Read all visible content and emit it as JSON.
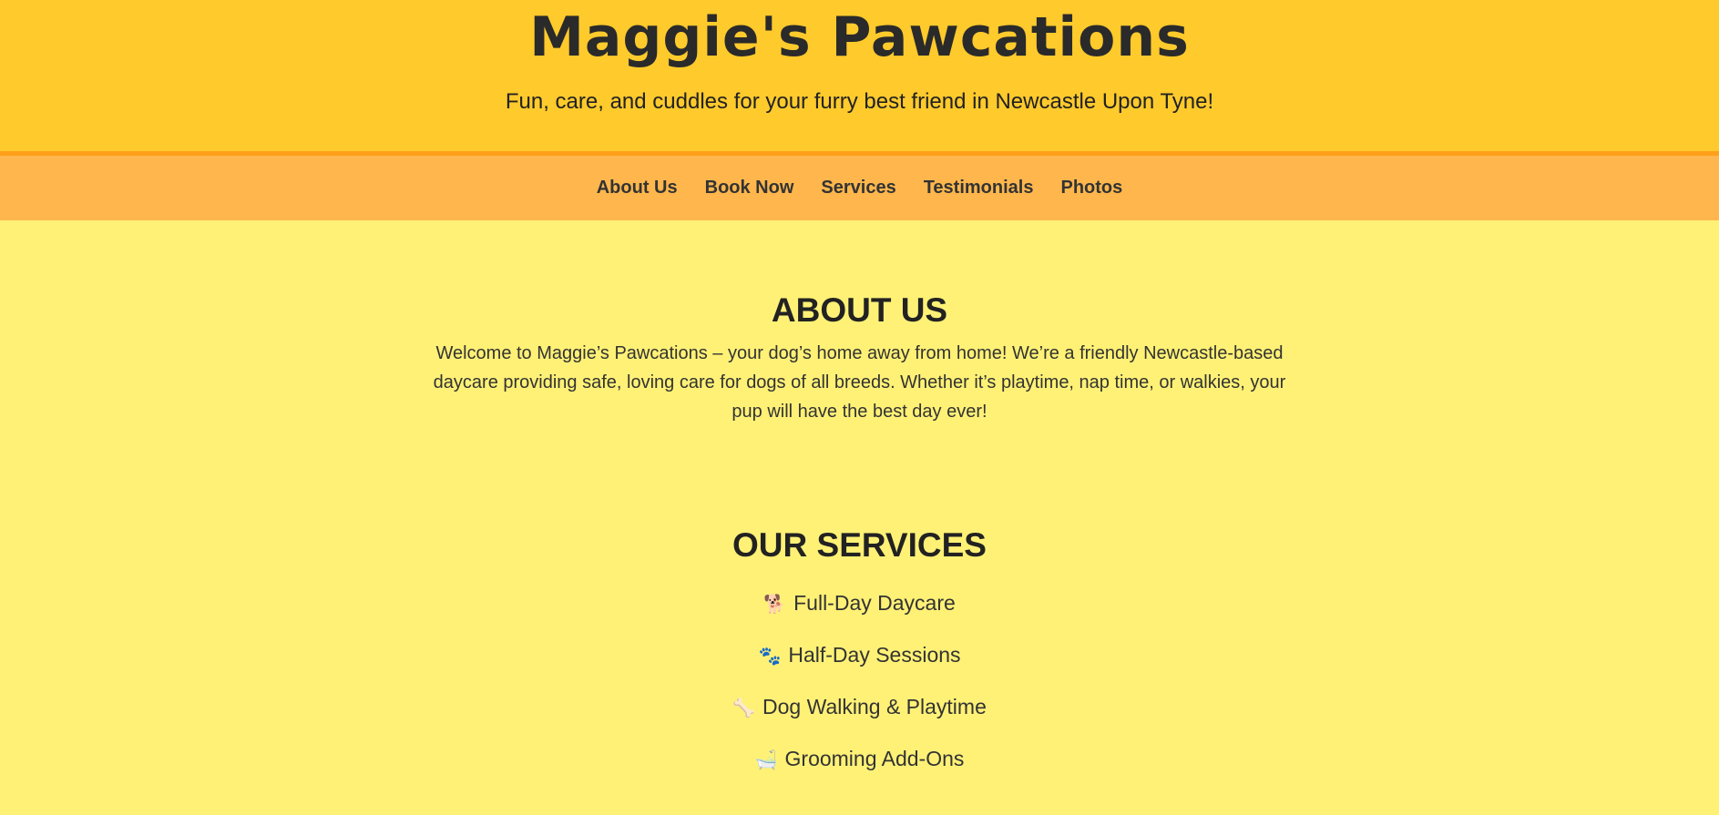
{
  "header": {
    "title": "Maggie's Pawcations",
    "tagline": "Fun, care, and cuddles for your furry best friend in Newcastle Upon Tyne!"
  },
  "nav": {
    "items": [
      {
        "label": "About Us"
      },
      {
        "label": "Book Now"
      },
      {
        "label": "Services"
      },
      {
        "label": "Testimonials"
      },
      {
        "label": "Photos"
      }
    ]
  },
  "about": {
    "heading": "ABOUT US",
    "text": "Welcome to Maggie’s Pawcations – your dog’s home away from home! We’re a friendly Newcastle-based daycare providing safe, loving care for dogs of all breeds. Whether it’s playtime, nap time, or walkies, your pup will have the best day ever!"
  },
  "services": {
    "heading": "OUR SERVICES",
    "items": [
      {
        "icon": "dog-icon",
        "glyph": "🐕",
        "label": "Full-Day Daycare"
      },
      {
        "icon": "paw-prints-icon",
        "glyph": "🐾",
        "label": "Half-Day Sessions"
      },
      {
        "icon": "bone-icon",
        "glyph": "🦴",
        "label": "Dog Walking & Playtime"
      },
      {
        "icon": "bathtub-icon",
        "glyph": "🛁",
        "label": "Grooming Add-Ons"
      }
    ]
  },
  "colors": {
    "header_bg": "#ffca2c",
    "header_border": "#ff9f1a",
    "nav_bg": "#ffb74d",
    "page_bg": "#fff176",
    "text": "#333333"
  }
}
